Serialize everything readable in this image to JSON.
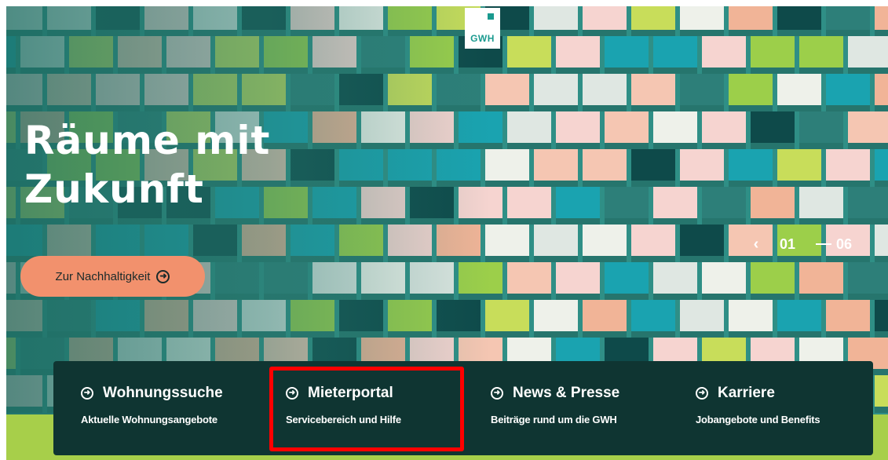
{
  "logo": {
    "text": "GWH",
    "brand_color": "#1a9a8f"
  },
  "hero": {
    "headline_line1": "Räume mit",
    "headline_line2": "Zukunft",
    "cta_label": "Zur Nachhaltigkeit",
    "cta_icon": "arrow-circle-right-icon",
    "cta_color": "#f2916d"
  },
  "slider": {
    "prev_icon": "chevron-left-icon",
    "current": "01",
    "total": "06",
    "progress_fraction": 0.5,
    "progress_color": "#9ccf4a"
  },
  "quicknav": {
    "items": [
      {
        "title": "Wohnungssuche",
        "subtitle": "Aktuelle Wohnungsangebote"
      },
      {
        "title": "Mieterportal",
        "subtitle": "Servicebereich und Hilfe"
      },
      {
        "title": "News & Presse",
        "subtitle": "Beiträge rund um die GWH"
      },
      {
        "title": "Karriere",
        "subtitle": "Jobangebote und Benefits"
      }
    ],
    "background": "#0f3532",
    "highlight_color": "#ff0000"
  }
}
